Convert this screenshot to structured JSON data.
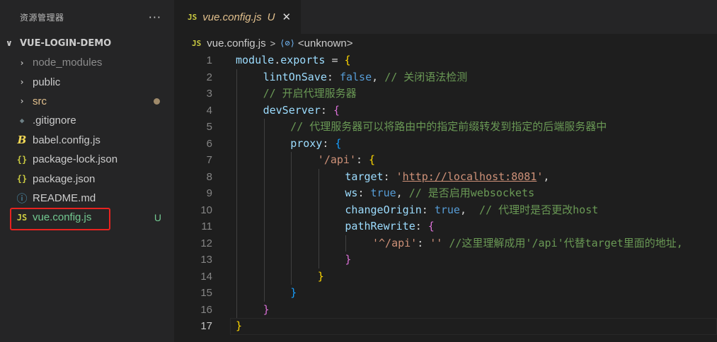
{
  "sidebar": {
    "title": "资源管理器",
    "more_label": "···",
    "project": "VUE-LOGIN-DEMO",
    "items": [
      {
        "label": "node_modules",
        "type": "folder",
        "color": "#8c8c8c"
      },
      {
        "label": "public",
        "type": "folder",
        "color": "#cccccc"
      },
      {
        "label": "src",
        "type": "folder",
        "color": "#e2c08d",
        "dot": true
      },
      {
        "label": ".gitignore",
        "type": "git",
        "color": "#cccccc"
      },
      {
        "label": "babel.config.js",
        "type": "babel",
        "color": "#cccccc"
      },
      {
        "label": "package-lock.json",
        "type": "json",
        "color": "#cccccc"
      },
      {
        "label": "package.json",
        "type": "json",
        "color": "#cccccc"
      },
      {
        "label": "README.md",
        "type": "info",
        "color": "#cccccc"
      },
      {
        "label": "vue.config.js",
        "type": "js",
        "color": "#73c991",
        "badge": "U"
      }
    ],
    "icons": {
      "folder": "chevron-right-icon",
      "git": "git-icon",
      "babel": "babel-icon",
      "json": "json-braces-icon",
      "info": "info-icon",
      "js": "js-file-icon"
    },
    "icon_glyphs": {
      "folder": "›",
      "git": "◆",
      "babel": "B",
      "json": "{}",
      "info": "ⓘ",
      "js": "JS"
    }
  },
  "tab": {
    "badge": "JS",
    "label": "vue.config.js",
    "modified": "U",
    "close": "✕"
  },
  "breadcrumb": {
    "badge": "JS",
    "file": "vue.config.js",
    "separator": ">",
    "symbol_icon": "⟨⊘⟩",
    "symbol": "<unknown>"
  },
  "colors": {
    "accent_js": "#cbcb41",
    "untracked": "#73c991",
    "modified": "#e2c08d",
    "highlight": "#e8231f"
  },
  "code": {
    "active_line": 17,
    "lines": [
      {
        "n": "1",
        "indent": 0,
        "tokens": [
          [
            "t-var",
            "module"
          ],
          [
            "t-p",
            "."
          ],
          [
            "t-var",
            "exports"
          ],
          [
            "t-p",
            " = "
          ],
          [
            "t-brace",
            "{"
          ]
        ]
      },
      {
        "n": "2",
        "indent": 1,
        "tokens": [
          [
            "t-var",
            "lintOnSave"
          ],
          [
            "t-p",
            ": "
          ],
          [
            "t-kw",
            "false"
          ],
          [
            "t-p",
            ", "
          ],
          [
            "t-cmt",
            "// 关闭语法检测"
          ]
        ]
      },
      {
        "n": "3",
        "indent": 1,
        "tokens": [
          [
            "t-cmt",
            "// 开启代理服务器"
          ]
        ]
      },
      {
        "n": "4",
        "indent": 1,
        "tokens": [
          [
            "t-var",
            "devServer"
          ],
          [
            "t-p",
            ": "
          ],
          [
            "t-brace2",
            "{"
          ]
        ]
      },
      {
        "n": "5",
        "indent": 2,
        "tokens": [
          [
            "t-cmt",
            "// 代理服务器可以将路由中的指定前缀转发到指定的后端服务器中"
          ]
        ]
      },
      {
        "n": "6",
        "indent": 2,
        "tokens": [
          [
            "t-var",
            "proxy"
          ],
          [
            "t-p",
            ": "
          ],
          [
            "t-brace3",
            "{"
          ]
        ]
      },
      {
        "n": "7",
        "indent": 3,
        "tokens": [
          [
            "t-str",
            "'/api'"
          ],
          [
            "t-p",
            ": "
          ],
          [
            "t-brace",
            "{"
          ]
        ]
      },
      {
        "n": "8",
        "indent": 4,
        "tokens": [
          [
            "t-var",
            "target"
          ],
          [
            "t-p",
            ": "
          ],
          [
            "t-str",
            "'"
          ],
          [
            "t-url",
            "http://localhost:8081"
          ],
          [
            "t-str",
            "'"
          ],
          [
            "t-p",
            ","
          ]
        ]
      },
      {
        "n": "9",
        "indent": 4,
        "tokens": [
          [
            "t-var",
            "ws"
          ],
          [
            "t-p",
            ": "
          ],
          [
            "t-kw",
            "true"
          ],
          [
            "t-p",
            ", "
          ],
          [
            "t-cmt",
            "// 是否启用websockets"
          ]
        ]
      },
      {
        "n": "10",
        "indent": 4,
        "tokens": [
          [
            "t-var",
            "changeOrigin"
          ],
          [
            "t-p",
            ": "
          ],
          [
            "t-kw",
            "true"
          ],
          [
            "t-p",
            ",  "
          ],
          [
            "t-cmt",
            "// 代理时是否更改host"
          ]
        ]
      },
      {
        "n": "11",
        "indent": 4,
        "tokens": [
          [
            "t-var",
            "pathRewrite"
          ],
          [
            "t-p",
            ": "
          ],
          [
            "t-brace2",
            "{"
          ]
        ]
      },
      {
        "n": "12",
        "indent": 5,
        "tokens": [
          [
            "t-str",
            "'^/api'"
          ],
          [
            "t-p",
            ": "
          ],
          [
            "t-str",
            "''"
          ],
          [
            "t-p",
            " "
          ],
          [
            "t-cmt",
            "//这里理解成用'/api'代替target里面的地址,"
          ]
        ]
      },
      {
        "n": "13",
        "indent": 4,
        "tokens": [
          [
            "t-brace2",
            "}"
          ]
        ]
      },
      {
        "n": "14",
        "indent": 3,
        "tokens": [
          [
            "t-brace",
            "}"
          ]
        ]
      },
      {
        "n": "15",
        "indent": 2,
        "tokens": [
          [
            "t-brace3",
            "}"
          ]
        ]
      },
      {
        "n": "16",
        "indent": 1,
        "tokens": [
          [
            "t-brace2",
            "}"
          ]
        ]
      },
      {
        "n": "17",
        "indent": 0,
        "tokens": [
          [
            "t-brace",
            "}"
          ]
        ]
      }
    ]
  }
}
